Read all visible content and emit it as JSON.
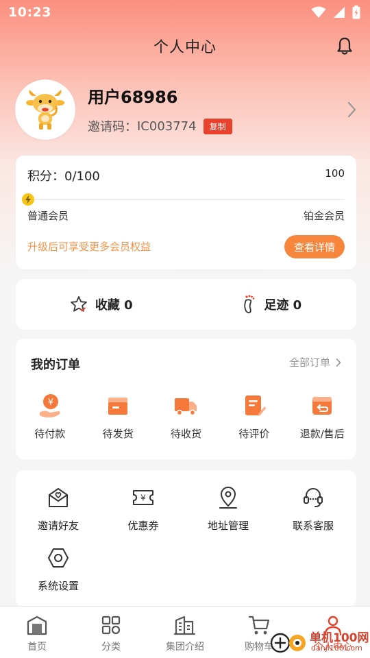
{
  "status_bar": {
    "time": "10:23"
  },
  "header": {
    "title": "个人中心"
  },
  "profile": {
    "username": "用户68986",
    "invite_label": "邀请码：",
    "invite_code": "IC003774",
    "copy_label": "复制"
  },
  "points": {
    "label": "积分：0/100",
    "max": "100",
    "progress_fraction": 0,
    "level_current": "普通会员",
    "level_next": "铂金会员",
    "upgrade_text": "升级后可享受更多会员权益",
    "detail_button": "查看详情"
  },
  "favorites": {
    "collect": "收藏 0",
    "footprint": "足迹 0"
  },
  "orders": {
    "title": "我的订单",
    "all_label": "全部订单",
    "items": [
      {
        "label": "待付款",
        "icon": "payment-icon"
      },
      {
        "label": "待发货",
        "icon": "box-icon"
      },
      {
        "label": "待收货",
        "icon": "truck-icon"
      },
      {
        "label": "待评价",
        "icon": "review-icon"
      },
      {
        "label": "退款/售后",
        "icon": "refund-icon"
      }
    ]
  },
  "tools": {
    "items": [
      {
        "label": "邀请好友",
        "icon": "invite-envelope-icon"
      },
      {
        "label": "优惠券",
        "icon": "coupon-icon"
      },
      {
        "label": "地址管理",
        "icon": "location-pin-icon"
      },
      {
        "label": "联系客服",
        "icon": "headset-icon"
      },
      {
        "label": "系统设置",
        "icon": "hexagon-settings-icon"
      }
    ]
  },
  "tabbar": {
    "items": [
      {
        "label": "首页",
        "icon": "home-icon"
      },
      {
        "label": "分类",
        "icon": "category-grid-icon"
      },
      {
        "label": "集团介绍",
        "icon": "building-icon"
      },
      {
        "label": "购物车",
        "icon": "cart-icon"
      },
      {
        "label": "个人中心",
        "icon": "user-icon"
      }
    ]
  },
  "watermark": {
    "text": "单机100网",
    "sub": "danji100.com"
  },
  "colors": {
    "accent": "#e8412c",
    "orange": "#f6863c",
    "knob": "#f5c518"
  }
}
